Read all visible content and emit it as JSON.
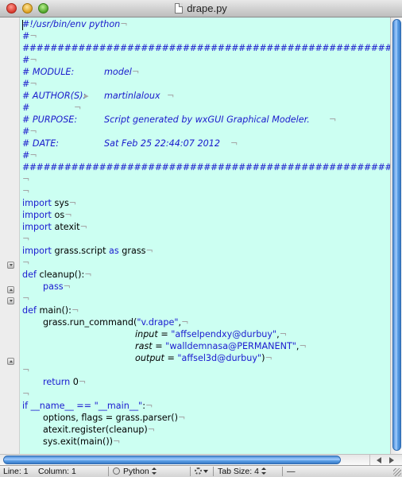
{
  "window": {
    "title": "drape.py"
  },
  "editor": {
    "pilcrow": "¬",
    "lines": {
      "l1": "#!/usr/bin/env python",
      "l2": "#",
      "l3": "##################################################################################",
      "l4": "#",
      "l5_key": "# MODULE:",
      "l5_val": "model",
      "l6": "#",
      "l7_key": "# AUTHOR(S):",
      "l7_tab": "▸",
      "l7_val": "martinlaloux",
      "l8": "#",
      "l9_key": "# PURPOSE:",
      "l9_val": "Script generated by wxGUI Graphical Modeler.",
      "l10": "#",
      "l11_key": "# DATE:",
      "l11_val": "Sat Feb 25 22:44:07 2012",
      "l12": "#",
      "l13": "##################################################################################",
      "import1_kw": "import",
      "import1_mod": " sys",
      "import2_kw": "import",
      "import2_mod": " os",
      "import3_kw": "import",
      "import3_mod": " atexit",
      "import4_kw": "import",
      "import4_mod": " grass.script ",
      "import4_as": "as",
      "import4_alias": " grass",
      "def1_kw": "def",
      "def1_rest": " cleanup():",
      "pass_kw": "pass",
      "def2_kw": "def",
      "def2_rest": " main():",
      "run_call": "grass.run_command(",
      "run_arg": "\"v.drape\"",
      "run_comma": ",",
      "kw_input": "input",
      "eq": " = ",
      "val_input": "\"affselpendxy@durbuy\"",
      "kw_rast": "rast",
      "val_rast": "\"walldemnasa@PERMANENT\"",
      "kw_output": "output",
      "val_output": "\"affsel3d@durbuy\"",
      "close_paren": ")",
      "return_kw": "return",
      "return_val": " 0",
      "if_kw": "if",
      "if_name": " __name__ ",
      "if_eq": "==",
      "if_main": " \"__main__\"",
      "if_colon": ":",
      "opts_line": "options, flags = grass.parser()",
      "atexit_line": "atexit.register(cleanup)",
      "exit_line": "sys.exit(main())"
    }
  },
  "statusbar": {
    "line_label": "Line:",
    "line_value": "1",
    "column_label": "Column:",
    "column_value": "1",
    "language": "Python",
    "tab_size_label": "Tab Size:",
    "tab_size_value": "4",
    "symbol": "—"
  },
  "colors": {
    "background": "#ccfff2",
    "comment": "#1a1acc",
    "keyword": "#1b1bd0",
    "scroll_thumb": "#5da2e8"
  },
  "icons": [
    "close-button",
    "minimize-button",
    "zoom-button",
    "file-icon",
    "fold-icon",
    "gear-icon",
    "language-icon",
    "resize-grip-icon"
  ]
}
